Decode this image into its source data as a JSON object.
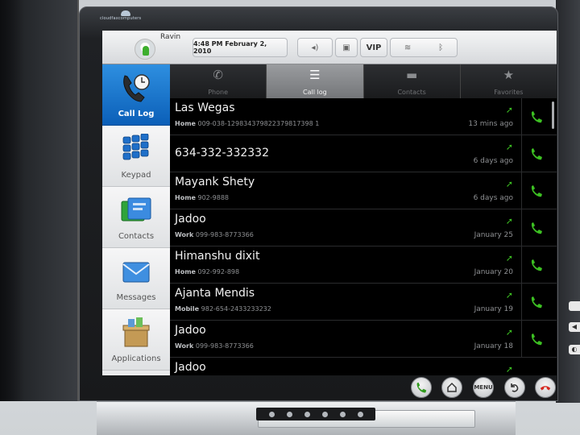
{
  "device": {
    "brand": "cloudfaxcomputers"
  },
  "status_bar": {
    "user_name": "Ravin",
    "clock": "4:48 PM  February 2, 2010",
    "vip_label": "VIP",
    "icons": [
      "speaker-icon",
      "lock-icon",
      "wifi-icon",
      "bluetooth-icon"
    ]
  },
  "nav": [
    {
      "label": "Call Log",
      "active": true
    },
    {
      "label": "Keypad",
      "active": false
    },
    {
      "label": "Contacts",
      "active": false
    },
    {
      "label": "Messages",
      "active": false
    },
    {
      "label": "Applications",
      "active": false
    }
  ],
  "tabs": [
    {
      "label": "Phone",
      "icon": "phone-icon",
      "active": false
    },
    {
      "label": "Call log",
      "active": true,
      "icon": "document-icon"
    },
    {
      "label": "Contacts",
      "icon": "contacts-icon",
      "active": false
    },
    {
      "label": "Favorites",
      "icon": "star-icon",
      "active": false
    }
  ],
  "call_log": [
    {
      "name": "Las Wegas",
      "type": "Home",
      "number": "009-038-129834379822379817398 1",
      "time": "13 mins ago"
    },
    {
      "name": "634-332-332332",
      "type": "",
      "number": "",
      "time": "6 days ago"
    },
    {
      "name": "Mayank Shety",
      "type": "Home",
      "number": "902-9888",
      "time": "6 days ago"
    },
    {
      "name": "Jadoo",
      "type": "Work",
      "number": "099-983-8773366",
      "time": "January 25"
    },
    {
      "name": "Himanshu dixit",
      "type": "Home",
      "number": "092-992-898",
      "time": "January 20"
    },
    {
      "name": "Ajanta Mendis",
      "type": "Mobile",
      "number": "982-654-2433233232",
      "time": "January 19"
    },
    {
      "name": "Jadoo",
      "type": "Work",
      "number": "099-983-8773366",
      "time": "January 18"
    },
    {
      "name": "Jadoo",
      "type": "",
      "number": "",
      "time": ""
    }
  ],
  "soft_keys": [
    {
      "name": "call-key",
      "label": ""
    },
    {
      "name": "home-key",
      "label": ""
    },
    {
      "name": "menu-key",
      "label": "MENU"
    },
    {
      "name": "back-key",
      "label": ""
    },
    {
      "name": "end-call-key",
      "label": ""
    }
  ],
  "colors": {
    "accent_blue": "#1d7bd4",
    "call_green": "#3cbf22",
    "end_red": "#d6261d"
  }
}
